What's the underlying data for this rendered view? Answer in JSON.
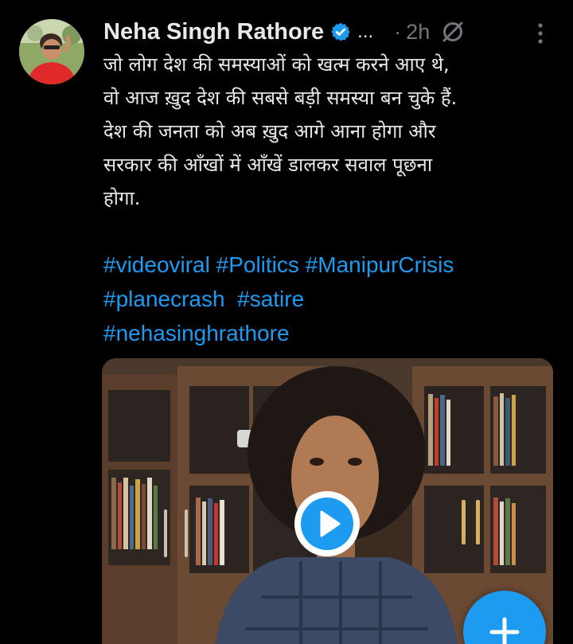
{
  "theme": {
    "background": "#000000",
    "text": "#e7e9ea",
    "muted": "#71767b",
    "accent": "#1d9bf0"
  },
  "author": {
    "name": "Neha Singh Rathore",
    "name_overflow": "...",
    "verified": true,
    "avatar": "profile-photo"
  },
  "meta": {
    "separator": "·",
    "timestamp": "2h",
    "grok_icon": "grok-slash-icon",
    "more_icon": "vertical-dots-icon"
  },
  "tweet": {
    "lines": [
      "जो लोग देश की समस्याओं को खत्म करने आए थे,",
      "वो आज ख़ुद देश की सबसे बड़ी समस्या बन चुके हैं.",
      "देश की जनता को अब ख़ुद आगे आना होगा और",
      "सरकार की आँखों में आँखें डालकर सवाल पूछना",
      "होगा."
    ],
    "hashtags": {
      "line1": [
        "#videoviral",
        "#Politics",
        "#ManipurCrisis"
      ],
      "line2": [
        "#planecrash",
        "#satire"
      ],
      "line3": [
        "#nehasinghrathore"
      ]
    }
  },
  "media": {
    "type": "video",
    "play_icon": "play-icon"
  },
  "compose": {
    "icon": "plus-icon"
  }
}
